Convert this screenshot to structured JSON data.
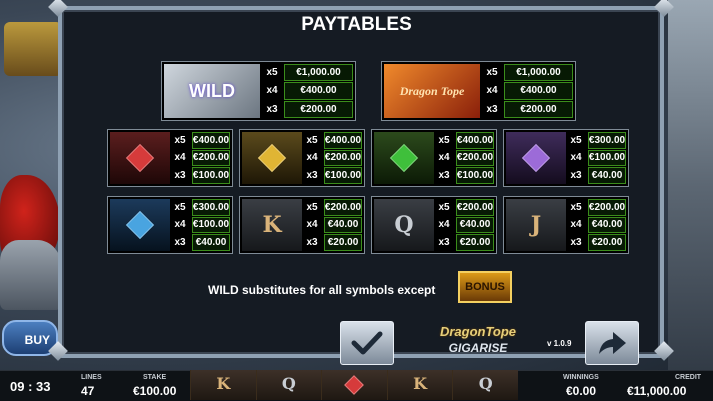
{
  "title": "PAYTABLES",
  "premium": [
    {
      "label": "WILD",
      "pays": [
        {
          "mult": "x5",
          "value": "€1,000.00"
        },
        {
          "mult": "x4",
          "value": "€400.00"
        },
        {
          "mult": "x3",
          "value": "€200.00"
        }
      ]
    },
    {
      "label": "Dragon Tope",
      "pays": [
        {
          "mult": "x5",
          "value": "€1,000.00"
        },
        {
          "mult": "x4",
          "value": "€400.00"
        },
        {
          "mult": "x3",
          "value": "€200.00"
        }
      ]
    }
  ],
  "symbols": [
    {
      "icon": "red-gem-icon",
      "color": "#d63b3b",
      "pays": [
        {
          "mult": "x5",
          "value": "€400.00"
        },
        {
          "mult": "x4",
          "value": "€200.00"
        },
        {
          "mult": "x3",
          "value": "€100.00"
        }
      ]
    },
    {
      "icon": "gold-gem-icon",
      "color": "#e0b534",
      "pays": [
        {
          "mult": "x5",
          "value": "€400.00"
        },
        {
          "mult": "x4",
          "value": "€200.00"
        },
        {
          "mult": "x3",
          "value": "€100.00"
        }
      ]
    },
    {
      "icon": "green-gem-icon",
      "color": "#3fbf3b",
      "pays": [
        {
          "mult": "x5",
          "value": "€400.00"
        },
        {
          "mult": "x4",
          "value": "€200.00"
        },
        {
          "mult": "x3",
          "value": "€100.00"
        }
      ]
    },
    {
      "icon": "purple-gem-icon",
      "color": "#9c6bd8",
      "pays": [
        {
          "mult": "x5",
          "value": "€300.00"
        },
        {
          "mult": "x4",
          "value": "€100.00"
        },
        {
          "mult": "x3",
          "value": "€40.00"
        }
      ]
    },
    {
      "icon": "blue-gem-icon",
      "color": "#49a4e0",
      "pays": [
        {
          "mult": "x5",
          "value": "€300.00"
        },
        {
          "mult": "x4",
          "value": "€100.00"
        },
        {
          "mult": "x3",
          "value": "€40.00"
        }
      ]
    },
    {
      "icon": "k-symbol-icon",
      "letter": "K",
      "pays": [
        {
          "mult": "x5",
          "value": "€200.00"
        },
        {
          "mult": "x4",
          "value": "€40.00"
        },
        {
          "mult": "x3",
          "value": "€20.00"
        }
      ]
    },
    {
      "icon": "q-symbol-icon",
      "letter": "Q",
      "pays": [
        {
          "mult": "x5",
          "value": "€200.00"
        },
        {
          "mult": "x4",
          "value": "€40.00"
        },
        {
          "mult": "x3",
          "value": "€20.00"
        }
      ]
    },
    {
      "icon": "j-symbol-icon",
      "letter": "J",
      "pays": [
        {
          "mult": "x5",
          "value": "€200.00"
        },
        {
          "mult": "x4",
          "value": "€40.00"
        },
        {
          "mult": "x3",
          "value": "€20.00"
        }
      ]
    }
  ],
  "note": "WILD substitutes for all symbols except",
  "bonus_label": "BONUS",
  "logo": {
    "top": "DragonTope",
    "bottom": "GIGARISE"
  },
  "version": "v 1.0.9",
  "background": {
    "buy_label": "BUY BO"
  },
  "status": {
    "time": "09 : 33",
    "lines_label": "LINES",
    "lines": "47",
    "stake_label": "STAKE",
    "stake": "€100.00",
    "winnings_label": "WINNINGS",
    "winnings": "€0.00",
    "credit_label": "CREDIT",
    "credit": "€11,000.00"
  },
  "reel_strip": [
    "K",
    "Q",
    "",
    "K",
    "Q"
  ]
}
